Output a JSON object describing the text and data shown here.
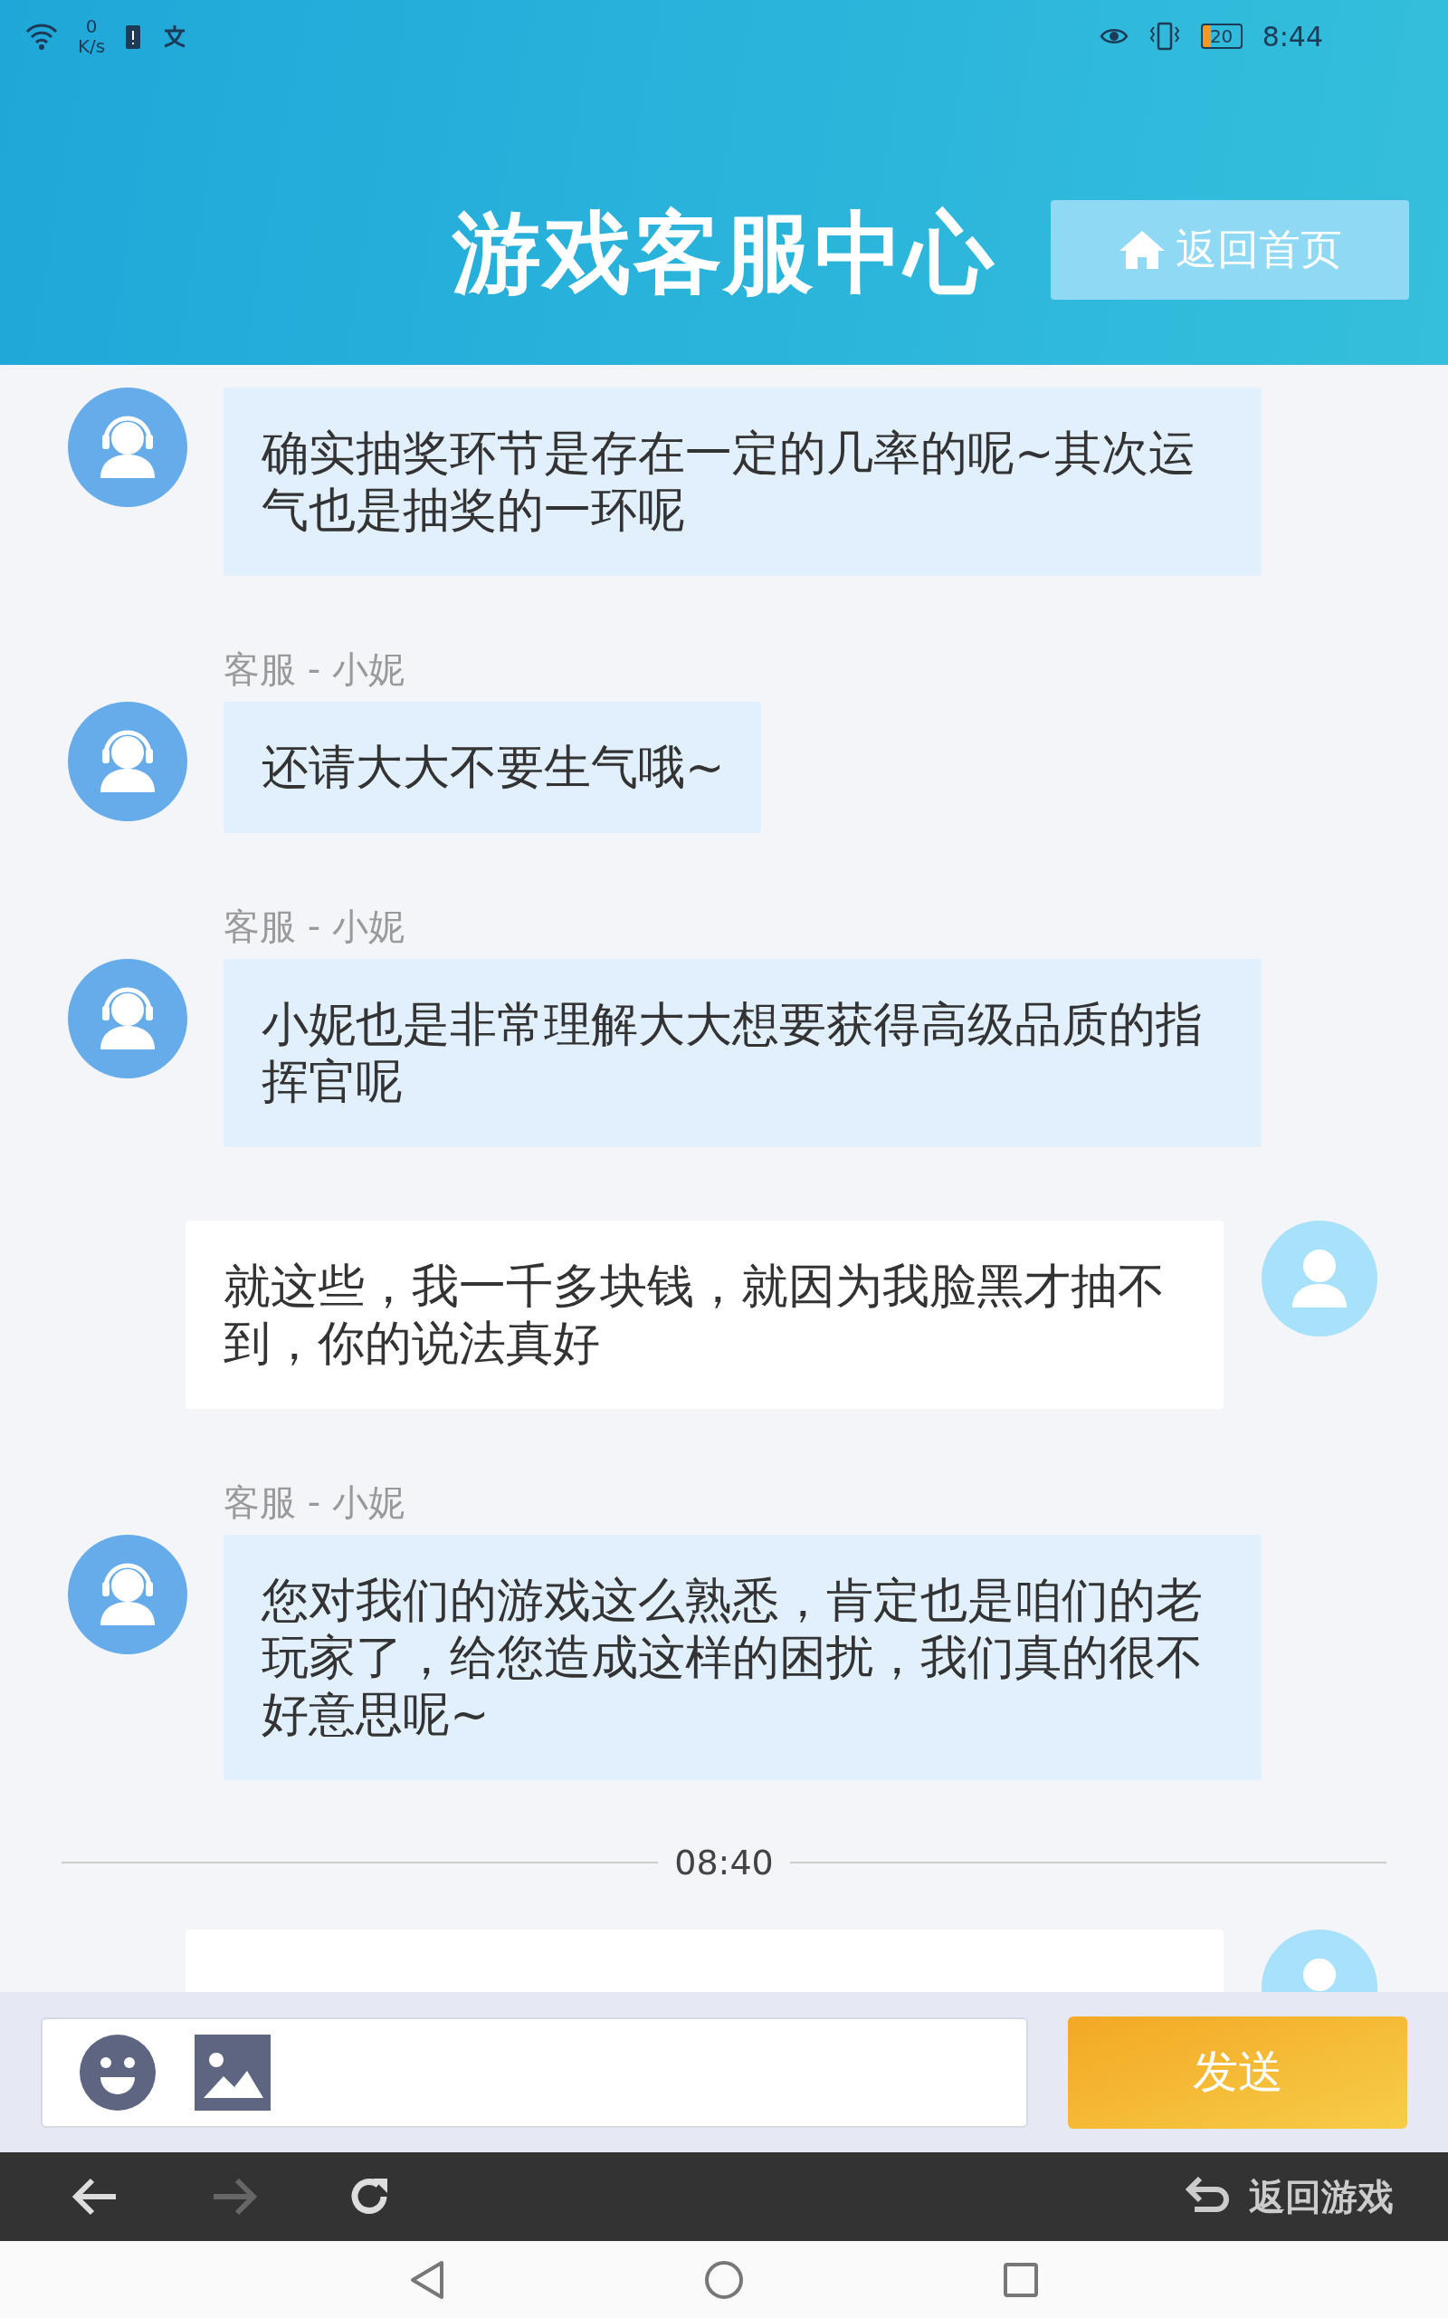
{
  "status_bar": {
    "speed_value": "0",
    "speed_unit": "K/s",
    "battery": "20",
    "time": "8:44"
  },
  "header": {
    "title": "游戏客服中心",
    "home_button": "返回首页"
  },
  "chat": [
    {
      "kind": "agent",
      "text": "确实抽奖环节是存在一定的几率的呢~其次运气也是抽奖的一环呢"
    },
    {
      "kind": "agent",
      "sender": "客服 - 小妮",
      "text": "还请大大不要生气哦~"
    },
    {
      "kind": "agent",
      "sender": "客服 - 小妮",
      "text": "小妮也是非常理解大大想要获得高级品质的指挥官呢"
    },
    {
      "kind": "user",
      "text": "就这些，我一千多块钱，就因为我脸黑才抽不到，你的说法真好"
    },
    {
      "kind": "agent",
      "sender": "客服 - 小妮",
      "text": "您对我们的游戏这么熟悉，肯定也是咱们的老玩家了，给您造成这样的困扰，我们真的很不好意思呢~"
    },
    {
      "kind": "time",
      "text": "08:40"
    },
    {
      "kind": "user"
    }
  ],
  "composer": {
    "send_button": "发送"
  },
  "browser_bar": {
    "back": {
      "disabled": false
    },
    "forward": {
      "disabled": true
    },
    "return_button": "返回游戏"
  }
}
